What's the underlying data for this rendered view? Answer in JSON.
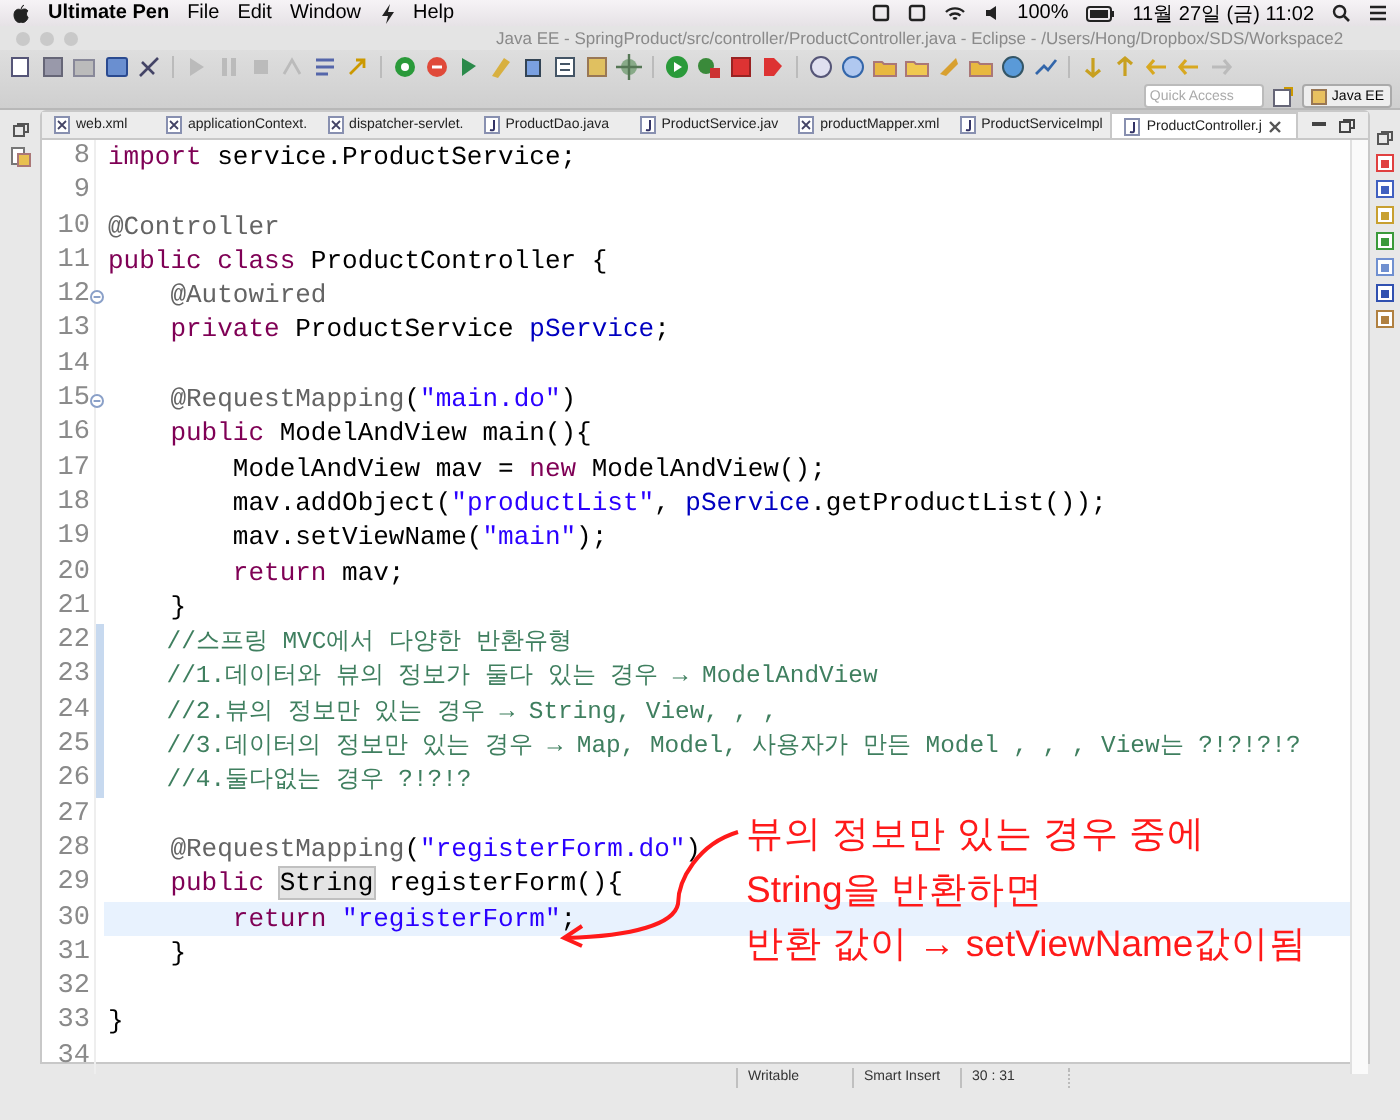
{
  "menu_bar": {
    "app_name": "Ultimate Pen",
    "menus": [
      {
        "kind": "text",
        "label": "File"
      },
      {
        "kind": "text",
        "label": "Edit"
      },
      {
        "kind": "text",
        "label": "Window"
      },
      {
        "kind": "icon"
      },
      {
        "kind": "text",
        "label": "Help"
      }
    ],
    "battery": "100%",
    "date_time": "11월 27일 (금)  11:02"
  },
  "window": {
    "title": "Java EE - SpringProduct/src/controller/ProductController.java - Eclipse - /Users/Hong/Dropbox/SDS/Workspace2"
  },
  "quick_access": {
    "placeholder": "Quick Access"
  },
  "perspective": {
    "label": "Java EE"
  },
  "tabs": [
    {
      "label": "web.xml",
      "kind": "xml",
      "selected": false
    },
    {
      "label": "applicationContext.",
      "kind": "xml",
      "selected": false
    },
    {
      "label": "dispatcher-servlet.",
      "kind": "xml",
      "selected": false
    },
    {
      "label": "ProductDao.java",
      "kind": "java",
      "selected": false
    },
    {
      "label": "ProductService.jav",
      "kind": "java",
      "selected": false
    },
    {
      "label": "productMapper.xml",
      "kind": "xml",
      "selected": false
    },
    {
      "label": "ProductServiceImpl",
      "kind": "java",
      "selected": false
    },
    {
      "label": "ProductController.j",
      "kind": "java",
      "selected": true
    }
  ],
  "editor": {
    "lines": [
      {
        "number": "8",
        "fold": false,
        "changed": false,
        "current": false,
        "segments": [
          {
            "kind": "keyword",
            "text": "import"
          },
          {
            "kind": "plain",
            "text": " service.ProductService;"
          }
        ]
      },
      {
        "number": "9",
        "fold": false,
        "changed": false,
        "current": false
      },
      {
        "number": "10",
        "fold": false,
        "changed": false,
        "current": false,
        "segments": [
          {
            "kind": "annotation",
            "text": "@Controller"
          }
        ]
      },
      {
        "number": "11",
        "fold": false,
        "changed": false,
        "current": false,
        "segments": [
          {
            "kind": "keyword",
            "text": "public class"
          },
          {
            "kind": "plain",
            "text": " ProductController {"
          }
        ]
      },
      {
        "number": "12",
        "fold": true,
        "changed": false,
        "current": false,
        "segments": [
          {
            "kind": "annotation",
            "text": "    @Autowired"
          }
        ]
      },
      {
        "number": "13",
        "fold": false,
        "changed": false,
        "current": false,
        "segments": [
          {
            "kind": "keyword",
            "text": "    private"
          },
          {
            "kind": "plain",
            "text": " ProductService "
          },
          {
            "kind": "field",
            "text": "pService"
          },
          {
            "kind": "plain",
            "text": ";"
          }
        ]
      },
      {
        "number": "14",
        "fold": false,
        "changed": false,
        "current": false
      },
      {
        "number": "15",
        "fold": true,
        "changed": false,
        "current": false,
        "segments": [
          {
            "kind": "annotation",
            "text": "    @RequestMapping"
          },
          {
            "kind": "plain",
            "text": "("
          },
          {
            "kind": "string",
            "text": "\"main.do\""
          },
          {
            "kind": "plain",
            "text": ")"
          }
        ]
      },
      {
        "number": "16",
        "fold": false,
        "changed": false,
        "current": false,
        "segments": [
          {
            "kind": "keyword",
            "text": "    public"
          },
          {
            "kind": "plain",
            "text": " ModelAndView main(){"
          }
        ]
      },
      {
        "number": "17",
        "fold": false,
        "changed": false,
        "current": false,
        "segments": [
          {
            "kind": "plain",
            "text": "        ModelAndView mav = "
          },
          {
            "kind": "keyword",
            "text": "new"
          },
          {
            "kind": "plain",
            "text": " ModelAndView();"
          }
        ]
      },
      {
        "number": "18",
        "fold": false,
        "changed": false,
        "current": false,
        "segments": [
          {
            "kind": "plain",
            "text": "        mav.addObject("
          },
          {
            "kind": "string",
            "text": "\"productList\""
          },
          {
            "kind": "plain",
            "text": ", "
          },
          {
            "kind": "field",
            "text": "pService"
          },
          {
            "kind": "plain",
            "text": ".getProductList());"
          }
        ]
      },
      {
        "number": "19",
        "fold": false,
        "changed": false,
        "current": false,
        "segments": [
          {
            "kind": "plain",
            "text": "        mav.setViewName("
          },
          {
            "kind": "string",
            "text": "\"main\""
          },
          {
            "kind": "plain",
            "text": ");"
          }
        ]
      },
      {
        "number": "20",
        "fold": false,
        "changed": false,
        "current": false,
        "segments": [
          {
            "kind": "keyword",
            "text": "        return"
          },
          {
            "kind": "plain",
            "text": " mav;"
          }
        ]
      },
      {
        "number": "21",
        "fold": false,
        "changed": false,
        "current": false,
        "segments": [
          {
            "kind": "plain",
            "text": "    }"
          }
        ]
      },
      {
        "number": "22",
        "fold": false,
        "changed": true,
        "current": false,
        "segments": [
          {
            "kind": "comment",
            "text": "    //스프링 MVC에서 다양한 반환유형"
          }
        ]
      },
      {
        "number": "23",
        "fold": false,
        "changed": true,
        "current": false,
        "segments": [
          {
            "kind": "comment",
            "text": "    //1.데이터와 뷰의 정보가 둘다 있는 경우 → ModelAndView"
          }
        ]
      },
      {
        "number": "24",
        "fold": false,
        "changed": true,
        "current": false,
        "segments": [
          {
            "kind": "comment",
            "text": "    //2.뷰의 정보만 있는 경우 → String, View, , ,"
          }
        ]
      },
      {
        "number": "25",
        "fold": false,
        "changed": true,
        "current": false,
        "segments": [
          {
            "kind": "comment",
            "text": "    //3.데이터의 정보만 있는 경우 → Map, Model, 사용자가 만든 Model , , , View는 ?!?!?!?"
          }
        ]
      },
      {
        "number": "26",
        "fold": false,
        "changed": true,
        "current": false,
        "segments": [
          {
            "kind": "comment",
            "text": "    //4.둘다없는 경우 ?!?!?"
          }
        ]
      },
      {
        "number": "27",
        "fold": false,
        "changed": false,
        "current": false
      },
      {
        "number": "28",
        "fold": false,
        "changed": false,
        "current": false,
        "segments": [
          {
            "kind": "annotation",
            "text": "    @RequestMapping"
          },
          {
            "kind": "plain",
            "text": "("
          },
          {
            "kind": "string",
            "text": "\"registerForm.do\""
          },
          {
            "kind": "plain",
            "text": ")"
          }
        ]
      },
      {
        "number": "29",
        "fold": false,
        "changed": false,
        "current": false,
        "segments": [
          {
            "kind": "keyword",
            "text": "    public "
          },
          {
            "kind": "marked",
            "text": "String"
          },
          {
            "kind": "plain",
            "text": " registerForm(){"
          }
        ]
      },
      {
        "number": "30",
        "fold": false,
        "changed": false,
        "current": true,
        "segments": [
          {
            "kind": "keyword",
            "text": "        return "
          },
          {
            "kind": "string",
            "text": "\"registerForm\""
          },
          {
            "kind": "plain",
            "text": ";"
          }
        ]
      },
      {
        "number": "31",
        "fold": false,
        "changed": false,
        "current": false,
        "segments": [
          {
            "kind": "plain",
            "text": "    }"
          }
        ]
      },
      {
        "number": "32",
        "fold": false,
        "changed": false,
        "current": false
      },
      {
        "number": "33",
        "fold": false,
        "changed": false,
        "current": false,
        "segments": [
          {
            "kind": "plain",
            "text": "}"
          }
        ]
      },
      {
        "number": "34",
        "fold": false,
        "changed": false,
        "current": false
      }
    ]
  },
  "annotation": {
    "lines": [
      "뷰의 정보만 있는 경우 중에",
      "String을 반환하면",
      "반환 값이 → setViewName값이됨"
    ]
  },
  "status_bar": {
    "mode": "Writable",
    "insert_mode": "Smart Insert",
    "position": "30 : 31"
  }
}
